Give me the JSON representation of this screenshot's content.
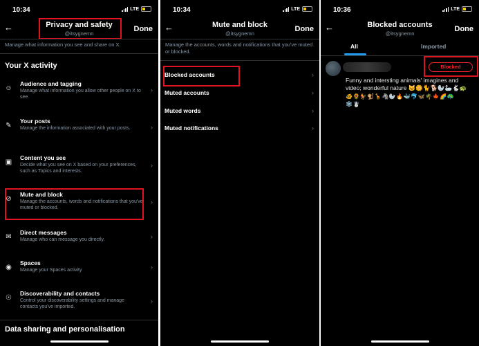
{
  "colors": {
    "background": "#000000",
    "text": "#e7e9ea",
    "muted": "#8b98a5",
    "accent": "#1d9bf0",
    "danger": "#f4212e",
    "highlight": "#e0141e"
  },
  "panel1": {
    "status": {
      "time": "10:34",
      "network": "LTE"
    },
    "title": "Privacy and safety",
    "handle": "@itsygnemn",
    "done": "Done",
    "description": "Manage what information you see and share on X.",
    "section": "Your X activity",
    "items": [
      {
        "icon": "people-tag-icon",
        "title": "Audience and tagging",
        "desc": "Manage what information you allow other people on X to see."
      },
      {
        "icon": "pencil-icon",
        "title": "Your posts",
        "desc": "Manage the information associated with your posts."
      },
      {
        "icon": "content-window-icon",
        "title": "Content you see",
        "desc": "Decide what you see on X based on your preferences, such as Topics and interests."
      },
      {
        "icon": "muted-speaker-icon",
        "title": "Mute and block",
        "desc": "Manage the accounts, words and notifications that you've muted or blocked."
      },
      {
        "icon": "envelope-icon",
        "title": "Direct messages",
        "desc": "Manage who can message you directly."
      },
      {
        "icon": "spaces-mic-icon",
        "title": "Spaces",
        "desc": "Manage your Spaces activity"
      },
      {
        "icon": "discover-contacts-icon",
        "title": "Discoverability and contacts",
        "desc": "Control your discoverability settings and manage contacts you've imported."
      }
    ],
    "section2": "Data sharing and personalisation"
  },
  "panel2": {
    "status": {
      "time": "10:34",
      "network": "LTE"
    },
    "title": "Mute and block",
    "handle": "@itsygnemn",
    "done": "Done",
    "description": "Manage the accounts, words and notifications that you've muted or blocked.",
    "items": [
      "Blocked accounts",
      "Muted accounts",
      "Muted words",
      "Muted notifications"
    ]
  },
  "panel3": {
    "status": {
      "time": "10:36",
      "network": "LTE"
    },
    "title": "Blocked accounts",
    "handle": "@itsygnemn",
    "done": "Done",
    "tabs": [
      "All",
      "Imported"
    ],
    "blocked_label": "Blocked",
    "bio": "Funny and intersting animals' imagines and video; wonderful nature 🐱🌼🐈🐕🦭🦢🐇🐢",
    "emoji_line1": "🐠🌻🐓🐒🦒🦓🦭🔥🐳🐬🦋🌴🍁🌈🦚",
    "emoji_line2": "❄️☃️"
  }
}
